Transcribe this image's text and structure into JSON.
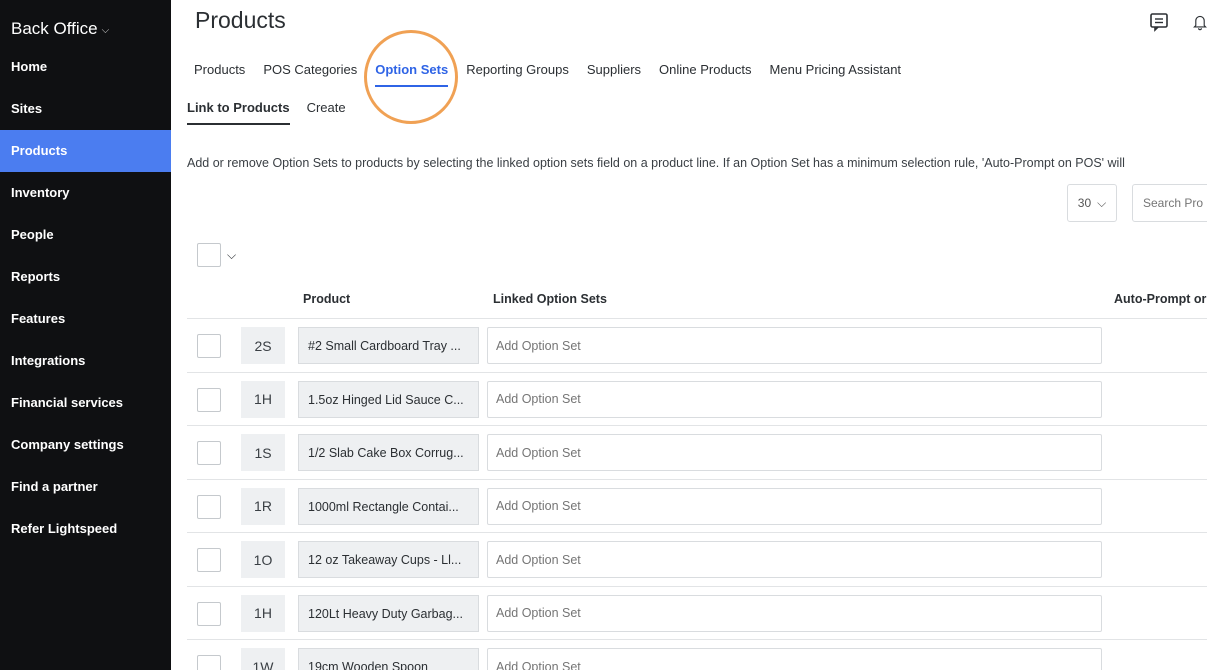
{
  "sidebar": {
    "brand": "Back Office",
    "items": [
      {
        "label": "Home"
      },
      {
        "label": "Sites"
      },
      {
        "label": "Products"
      },
      {
        "label": "Inventory"
      },
      {
        "label": "People"
      },
      {
        "label": "Reports"
      },
      {
        "label": "Features"
      },
      {
        "label": "Integrations"
      },
      {
        "label": "Financial services"
      },
      {
        "label": "Company settings"
      },
      {
        "label": "Find a partner"
      },
      {
        "label": "Refer Lightspeed"
      }
    ],
    "active_item": "Products"
  },
  "header": {
    "title": "Products",
    "icons": [
      "chat-icon",
      "bell-icon"
    ]
  },
  "tabs": [
    "Products",
    "POS Categories",
    "Option Sets",
    "Reporting Groups",
    "Suppliers",
    "Online Products",
    "Menu Pricing Assistant"
  ],
  "active_tab": "Option Sets",
  "subtabs": [
    "Link to Products",
    "Create"
  ],
  "active_subtab": "Link to Products",
  "description": "Add or remove Option Sets to products by selecting the linked option sets field on a product line. If an Option Set has a minimum selection rule, 'Auto-Prompt on POS' will",
  "per_page": "30",
  "search": {
    "placeholder": "Search Pro"
  },
  "table": {
    "headers": {
      "product": "Product",
      "linked": "Linked Option Sets",
      "auto": "Auto-Prompt or"
    },
    "option_placeholder": "Add Option Set",
    "rows": [
      {
        "abbr": "2S",
        "name": "#2 Small Cardboard Tray ..."
      },
      {
        "abbr": "1H",
        "name": "1.5oz Hinged Lid Sauce C..."
      },
      {
        "abbr": "1S",
        "name": "1/2 Slab Cake Box Corrug..."
      },
      {
        "abbr": "1R",
        "name": "1000ml Rectangle Contai..."
      },
      {
        "abbr": "1O",
        "name": "12 oz Takeaway Cups - Ll..."
      },
      {
        "abbr": "1H",
        "name": "120Lt Heavy Duty Garbag..."
      },
      {
        "abbr": "1W",
        "name": "19cm Wooden Spoon"
      }
    ]
  },
  "colors": {
    "accent": "#2f64e6",
    "sidebar_bg": "#0f1012",
    "active_nav": "#4b7df0",
    "highlight_ring": "#f0a154"
  }
}
